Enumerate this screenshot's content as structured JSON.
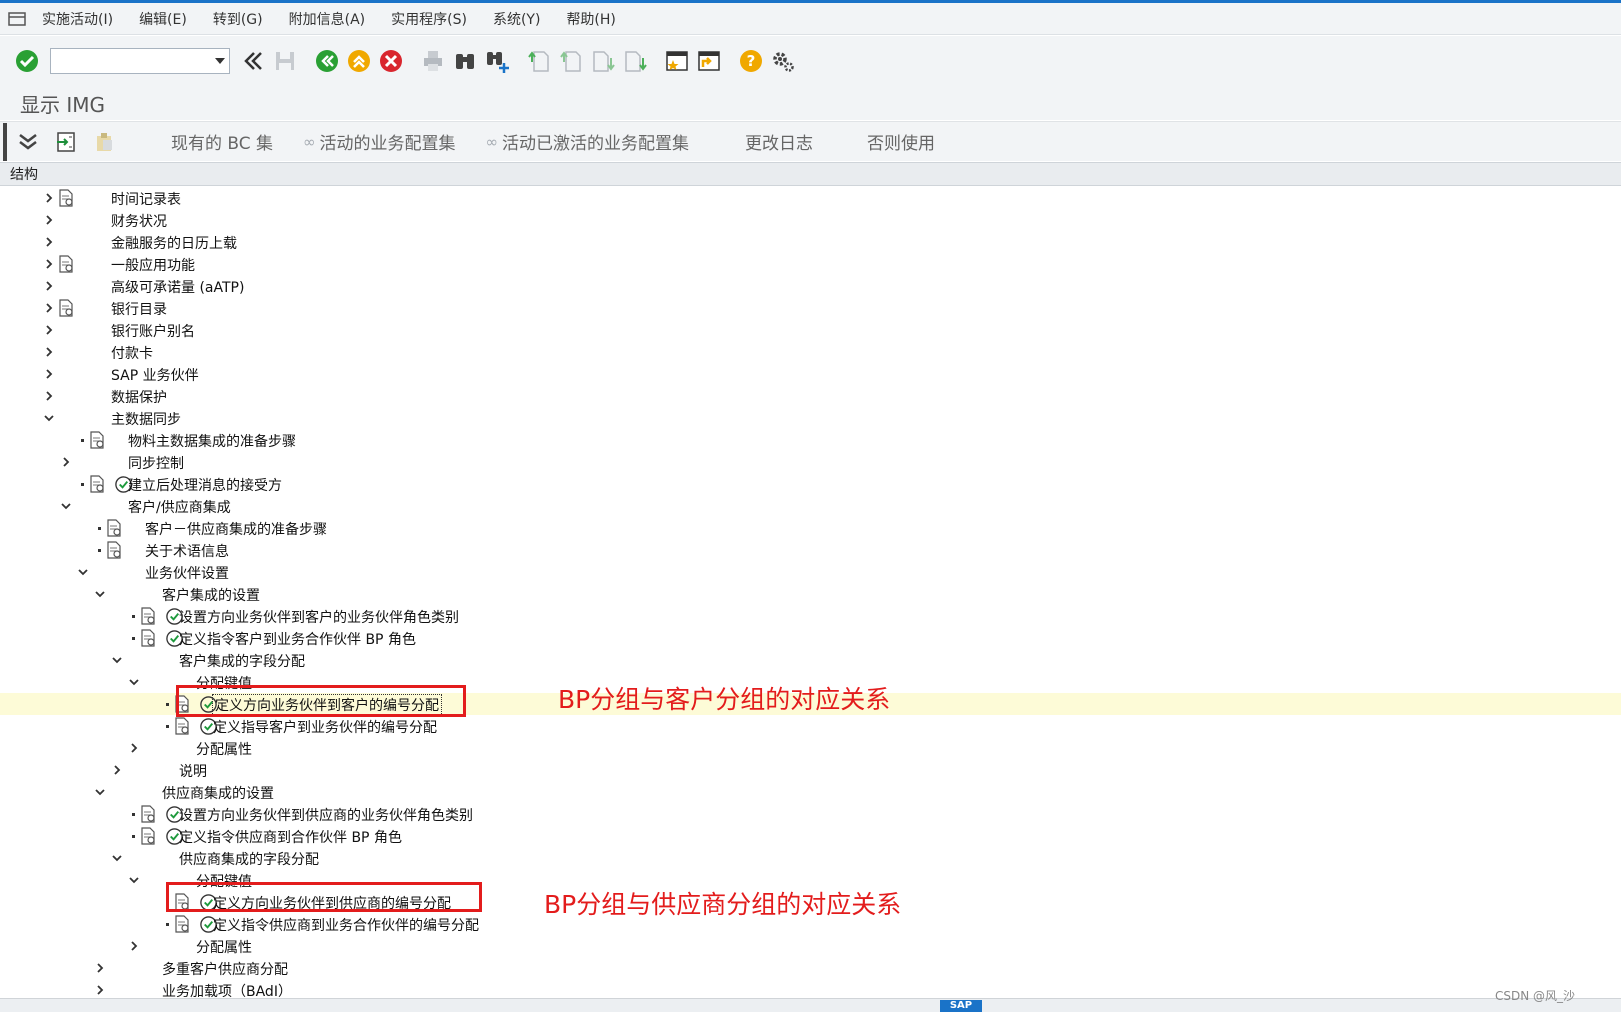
{
  "menu": {
    "items": [
      "实施活动(I)",
      "编辑(E)",
      "转到(G)",
      "附加信息(A)",
      "实用程序(S)",
      "系统(Y)",
      "帮助(H)"
    ]
  },
  "toolbar": {
    "icons": [
      "enter-icon",
      "command-field",
      "back-history-icon",
      "save-icon",
      "back-icon",
      "exit-icon",
      "cancel-icon",
      "print-icon",
      "find-icon",
      "find-next-icon",
      "first-page-icon",
      "previous-page-icon",
      "next-page-icon",
      "last-page-icon",
      "create-session-icon",
      "shortcut-icon",
      "help-icon",
      "settings-icon"
    ],
    "command_value": ""
  },
  "page": {
    "title": "显示 IMG"
  },
  "app_toolbar": {
    "buttons": [
      "现有的 BC 集",
      "活动的业务配置集",
      "活动已激活的业务配置集",
      "更改日志",
      "否则使用"
    ]
  },
  "column_header": "结构",
  "tree": [
    {
      "label": "时间记录表",
      "state": "collapsed",
      "level": 0,
      "doc": true,
      "exec": false
    },
    {
      "label": "财务状况",
      "state": "collapsed",
      "level": 0,
      "doc": false,
      "exec": false
    },
    {
      "label": "金融服务的日历上载",
      "state": "collapsed",
      "level": 0,
      "doc": false,
      "exec": false
    },
    {
      "label": "一般应用功能",
      "state": "collapsed",
      "level": 0,
      "doc": true,
      "exec": false
    },
    {
      "label": "高级可承诺量 (aATP)",
      "state": "collapsed",
      "level": 0,
      "doc": false,
      "exec": false
    },
    {
      "label": "银行目录",
      "state": "collapsed",
      "level": 0,
      "doc": true,
      "exec": false
    },
    {
      "label": "银行账户别名",
      "state": "collapsed",
      "level": 0,
      "doc": false,
      "exec": false
    },
    {
      "label": "付款卡",
      "state": "collapsed",
      "level": 0,
      "doc": false,
      "exec": false
    },
    {
      "label": "SAP 业务伙伴",
      "state": "collapsed",
      "level": 0,
      "doc": false,
      "exec": false
    },
    {
      "label": "数据保护",
      "state": "collapsed",
      "level": 0,
      "doc": false,
      "exec": false
    },
    {
      "label": "主数据同步",
      "state": "expanded",
      "level": 0,
      "doc": false,
      "exec": false
    },
    {
      "label": "物料主数据集成的准备步骤",
      "state": "leaf",
      "level": 1,
      "doc": true,
      "exec": false
    },
    {
      "label": "同步控制",
      "state": "collapsed",
      "level": 1,
      "doc": false,
      "exec": false
    },
    {
      "label": "建立后处理消息的接受方",
      "state": "leaf",
      "level": 1,
      "doc": true,
      "exec": true
    },
    {
      "label": "客户/供应商集成",
      "state": "expanded",
      "level": 1,
      "doc": false,
      "exec": false
    },
    {
      "label": "客户－供应商集成的准备步骤",
      "state": "leaf",
      "level": 2,
      "doc": true,
      "exec": false
    },
    {
      "label": "关于术语信息",
      "state": "leaf",
      "level": 2,
      "doc": true,
      "exec": false
    },
    {
      "label": "业务伙伴设置",
      "state": "expanded",
      "level": 2,
      "doc": false,
      "exec": false
    },
    {
      "label": "客户集成的设置",
      "state": "expanded",
      "level": 3,
      "doc": false,
      "exec": false
    },
    {
      "label": "设置方向业务伙伴到客户的业务伙伴角色类别",
      "state": "leaf",
      "level": 4,
      "doc": true,
      "exec": true
    },
    {
      "label": "定义指令客户到业务合作伙伴 BP 角色",
      "state": "leaf",
      "level": 4,
      "doc": true,
      "exec": true
    },
    {
      "label": "客户集成的字段分配",
      "state": "expanded",
      "level": 4,
      "doc": false,
      "exec": false
    },
    {
      "label": "分配键值",
      "state": "expanded",
      "level": 5,
      "doc": false,
      "exec": false
    },
    {
      "label": "定义方向业务伙伴到客户的编号分配",
      "state": "leaf",
      "level": 6,
      "doc": true,
      "exec": true,
      "selected": true
    },
    {
      "label": "定义指导客户到业务伙伴的编号分配",
      "state": "leaf",
      "level": 6,
      "doc": true,
      "exec": true
    },
    {
      "label": "分配属性",
      "state": "collapsed",
      "level": 5,
      "doc": false,
      "exec": false
    },
    {
      "label": "说明",
      "state": "collapsed",
      "level": 4,
      "doc": false,
      "exec": false
    },
    {
      "label": "供应商集成的设置",
      "state": "expanded",
      "level": 3,
      "doc": false,
      "exec": false
    },
    {
      "label": "设置方向业务伙伴到供应商的业务伙伴角色类别",
      "state": "leaf",
      "level": 4,
      "doc": true,
      "exec": true
    },
    {
      "label": "定义指令供应商到合作伙伴 BP 角色",
      "state": "leaf",
      "level": 4,
      "doc": true,
      "exec": true
    },
    {
      "label": "供应商集成的字段分配",
      "state": "expanded",
      "level": 4,
      "doc": false,
      "exec": false
    },
    {
      "label": "分配键值",
      "state": "expanded",
      "level": 5,
      "doc": false,
      "exec": false
    },
    {
      "label": "定义方向业务伙伴到供应商的编号分配",
      "state": "leaf",
      "level": 6,
      "doc": true,
      "exec": true
    },
    {
      "label": "定义指令供应商到业务合作伙伴的编号分配",
      "state": "leaf",
      "level": 6,
      "doc": true,
      "exec": true
    },
    {
      "label": "分配属性",
      "state": "collapsed",
      "level": 5,
      "doc": false,
      "exec": false
    },
    {
      "label": "多重客户供应商分配",
      "state": "collapsed",
      "level": 3,
      "doc": false,
      "exec": false
    },
    {
      "label": "业务加载项（BAdI）",
      "state": "collapsed",
      "level": 3,
      "doc": false,
      "exec": false
    }
  ],
  "annotations": [
    {
      "text": "BP分组与客户分组的对应关系",
      "color": "#e31c1c"
    },
    {
      "text": "BP分组与供应商分组的对应关系",
      "color": "#e31c1c"
    }
  ],
  "watermark": "CSDN @风_沙",
  "colors": {
    "highlight_row": "#fdfbd7",
    "annotation": "#e31c1c",
    "accent": "#1a73c8"
  }
}
